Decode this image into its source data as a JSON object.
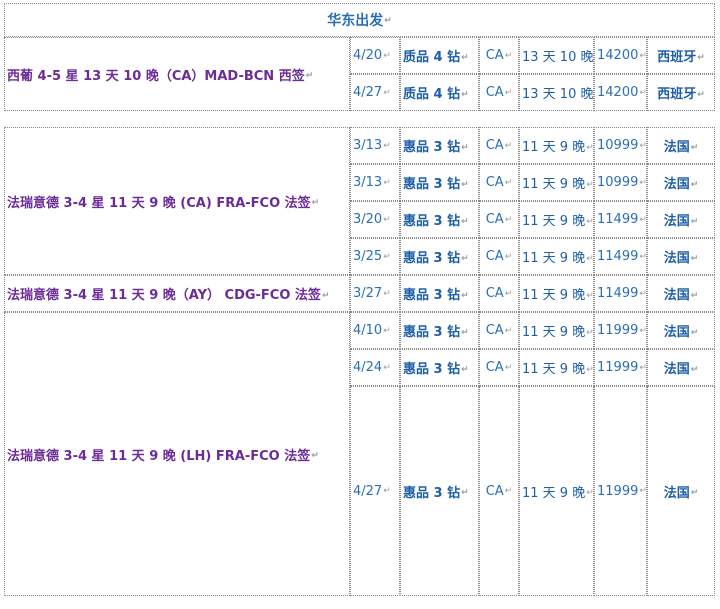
{
  "title": "华东出发",
  "para_mark": "↵",
  "groups": [
    {
      "route": "西葡 4-5 星 13 天 10 晚（CA）MAD-BCN 西签",
      "rows": [
        {
          "date": "4/20",
          "cls": "质品 4 钻",
          "air": "CA",
          "days": "13 天 10 晚",
          "price": "14200",
          "visa": "西班牙"
        },
        {
          "date": "4/27",
          "cls": "质品 4 钻",
          "air": "CA",
          "days": "13 天 10 晚",
          "price": "14200",
          "visa": "西班牙"
        }
      ]
    },
    {
      "route": "法瑞意德 3-4 星 11 天 9 晚 (CA) FRA-FCO 法签",
      "rows": [
        {
          "date": "3/13",
          "cls": "惠品 3 钻",
          "air": "CA",
          "days": "11 天 9 晚",
          "price": "10999",
          "visa": "法国"
        },
        {
          "date": "3/13",
          "cls": "惠品 3 钻",
          "air": "CA",
          "days": "11 天 9 晚",
          "price": "10999",
          "visa": "法国"
        },
        {
          "date": "3/20",
          "cls": "惠品 3 钻",
          "air": "CA",
          "days": "11 天 9 晚",
          "price": "11499",
          "visa": "法国"
        },
        {
          "date": "3/25",
          "cls": "惠品 3 钻",
          "air": "CA",
          "days": "11 天 9 晚",
          "price": "11499",
          "visa": "法国"
        }
      ]
    },
    {
      "route": "法瑞意德 3-4 星 11 天 9 晚（AY） CDG-FCO 法签",
      "rows": [
        {
          "date": "3/27",
          "cls": "惠品 3 钻",
          "air": "CA",
          "days": "11 天 9 晚",
          "price": "11499",
          "visa": "法国"
        }
      ]
    },
    {
      "route": "法瑞意德 3-4 星 11 天 9 晚 (LH) FRA-FCO 法签",
      "rows": [
        {
          "date": "4/10",
          "cls": "惠品 3 钻",
          "air": "CA",
          "days": "11 天 9 晚",
          "price": "11999",
          "visa": "法国"
        },
        {
          "date": "4/24",
          "cls": "惠品 3 钻",
          "air": "CA",
          "days": "11 天 9 晚",
          "price": "11999",
          "visa": "法国"
        },
        {
          "date": "4/27",
          "cls": "惠品 3 钻",
          "air": "CA",
          "days": "11 天 9 晚",
          "price": "11999",
          "visa": "法国"
        }
      ]
    }
  ]
}
